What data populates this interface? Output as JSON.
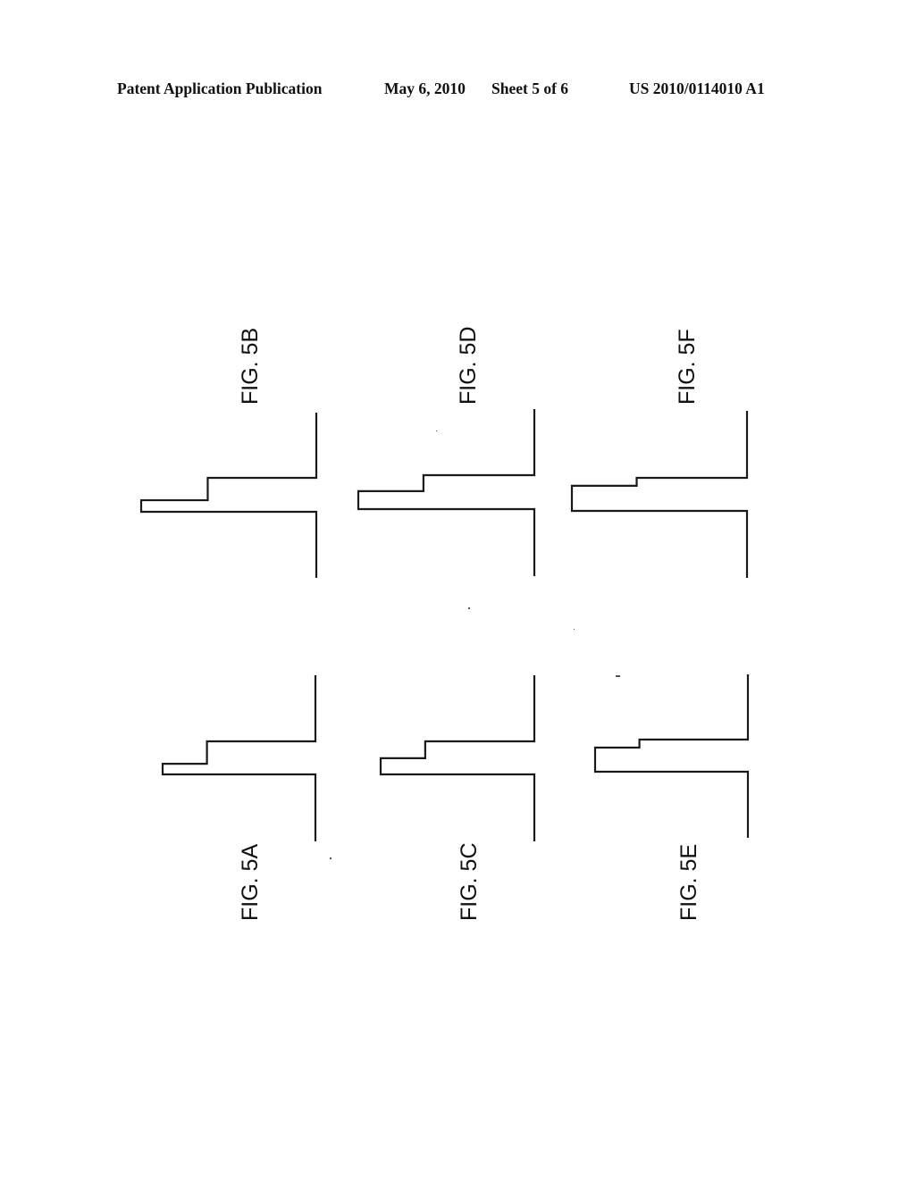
{
  "header": {
    "publication": "Patent Application Publication",
    "date": "May 6, 2010",
    "sheet": "Sheet 5 of 6",
    "number": "US 2010/0114010 A1"
  },
  "figures": [
    {
      "id": "5A",
      "label": "FIG. 5A",
      "profile": {
        "outer_step_depth": 1.0,
        "inner_step_depth": 0.71,
        "outer_step_height": 0.32,
        "inner_step_height": 0.68
      }
    },
    {
      "id": "5B",
      "label": "FIG. 5B",
      "profile": {
        "outer_step_depth": 1.0,
        "inner_step_depth": 0.62,
        "outer_step_height": 0.34,
        "inner_step_height": 0.66
      }
    },
    {
      "id": "5C",
      "label": "FIG. 5C",
      "profile": {
        "outer_step_depth": 1.0,
        "inner_step_depth": 0.71,
        "outer_step_height": 0.49,
        "inner_step_height": 0.51
      }
    },
    {
      "id": "5D",
      "label": "FIG. 5D",
      "profile": {
        "outer_step_depth": 1.0,
        "inner_step_depth": 0.63,
        "outer_step_height": 0.53,
        "inner_step_height": 0.47
      }
    },
    {
      "id": "5E",
      "label": "FIG. 5E",
      "profile": {
        "outer_step_depth": 1.0,
        "inner_step_depth": 0.71,
        "outer_step_height": 0.75,
        "inner_step_height": 0.25
      }
    },
    {
      "id": "5F",
      "label": "FIG. 5F",
      "profile": {
        "outer_step_depth": 1.0,
        "inner_step_depth": 0.63,
        "outer_step_height": 0.76,
        "inner_step_height": 0.24
      }
    }
  ]
}
